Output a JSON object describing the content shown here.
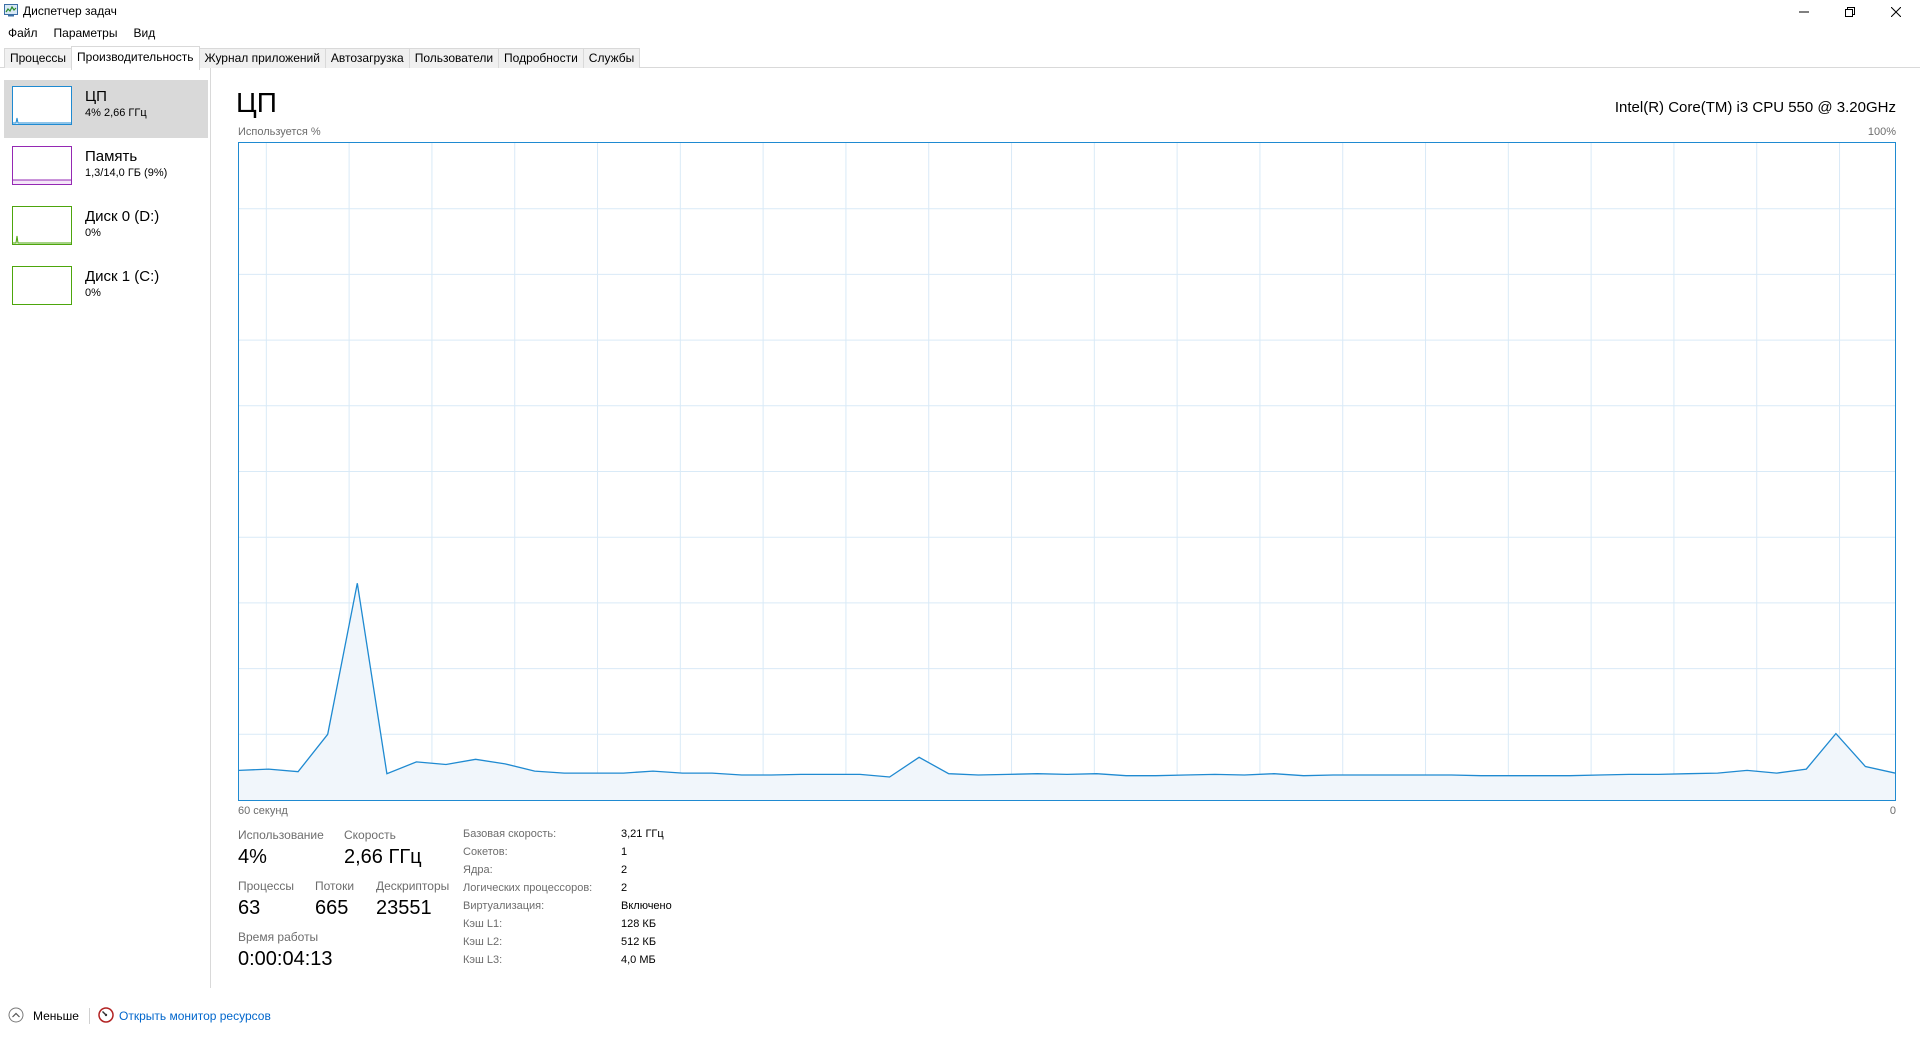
{
  "window": {
    "title": "Диспетчер задач"
  },
  "menu": [
    "Файл",
    "Параметры",
    "Вид"
  ],
  "tabs": [
    {
      "label": "Процессы",
      "active": false
    },
    {
      "label": "Производительность",
      "active": true
    },
    {
      "label": "Журнал приложений",
      "active": false
    },
    {
      "label": "Автозагрузка",
      "active": false
    },
    {
      "label": "Пользователи",
      "active": false
    },
    {
      "label": "Подробности",
      "active": false
    },
    {
      "label": "Службы",
      "active": false
    }
  ],
  "sidebar": {
    "items": [
      {
        "title": "ЦП",
        "sub": "4% 2,66 ГГц",
        "color": "#1f8ad1"
      },
      {
        "title": "Память",
        "sub": "1,3/14,0 ГБ (9%)",
        "color": "#9528b4"
      },
      {
        "title": "Диск 0 (D:)",
        "sub": "0%",
        "color": "#4da60c"
      },
      {
        "title": "Диск 1 (C:)",
        "sub": "0%",
        "color": "#4da60c"
      }
    ]
  },
  "main": {
    "title": "ЦП",
    "cpu_name": "Intel(R) Core(TM) i3 CPU 550 @ 3.20GHz",
    "graph_top_left": "Используется %",
    "graph_top_right": "100%",
    "graph_bottom_left": "60 секунд",
    "graph_bottom_right": "0"
  },
  "chart_data": {
    "type": "area",
    "x_range_seconds": [
      60,
      0
    ],
    "ylim": [
      0,
      100
    ],
    "grid": true,
    "color": "#1f8ad1",
    "values": [
      4.5,
      4.7,
      4.3,
      10,
      33,
      4,
      5.8,
      5.4,
      6.2,
      5.5,
      4.4,
      4.1,
      4.1,
      4.1,
      4.4,
      4.1,
      4.1,
      3.8,
      3.8,
      3.9,
      3.9,
      3.9,
      3.5,
      6.5,
      4,
      3.8,
      3.9,
      4,
      3.9,
      4,
      3.7,
      3.7,
      3.8,
      3.9,
      3.8,
      4,
      3.7,
      3.8,
      3.8,
      3.8,
      3.8,
      3.8,
      3.7,
      3.7,
      3.7,
      3.7,
      3.8,
      3.9,
      3.9,
      4,
      4.1,
      4.5,
      4.1,
      4.7,
      10.1,
      5.1,
      4.1
    ]
  },
  "stats": {
    "usage_label": "Использование",
    "usage_value": "4%",
    "speed_label": "Скорость",
    "speed_value": "2,66 ГГц",
    "processes_label": "Процессы",
    "processes_value": "63",
    "threads_label": "Потоки",
    "threads_value": "665",
    "handles_label": "Дескрипторы",
    "handles_value": "23551",
    "uptime_label": "Время работы",
    "uptime_value": "0:00:04:13"
  },
  "specs": [
    {
      "label": "Базовая скорость:",
      "value": "3,21 ГГц"
    },
    {
      "label": "Сокетов:",
      "value": "1"
    },
    {
      "label": "Ядра:",
      "value": "2"
    },
    {
      "label": "Логических процессоров:",
      "value": "2"
    },
    {
      "label": "Виртуализация:",
      "value": "Включено"
    },
    {
      "label": "Кэш L1:",
      "value": "128 КБ"
    },
    {
      "label": "Кэш L2:",
      "value": "512 КБ"
    },
    {
      "label": "Кэш L3:",
      "value": "4,0 МБ"
    }
  ],
  "footer": {
    "less_label": "Меньше",
    "monitor_label": "Открыть монитор ресурсов"
  }
}
